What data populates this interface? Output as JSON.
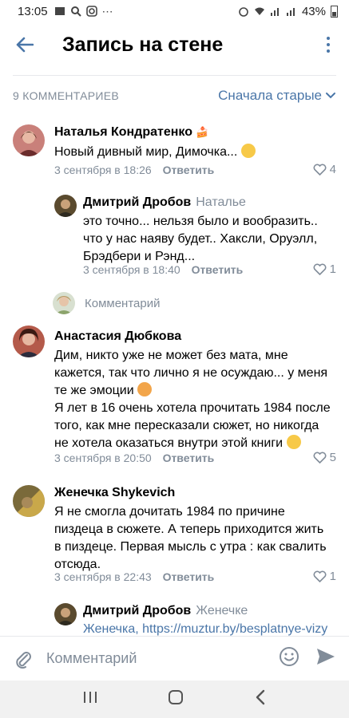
{
  "status": {
    "time": "13:05",
    "battery": "43%"
  },
  "header": {
    "title": "Запись на стене"
  },
  "comments_header": {
    "count": "9 КОММЕНТАРИЕВ",
    "sort": "Сначала старые"
  },
  "comments": [
    {
      "author": "Наталья Кондратенко",
      "text": "Новый дивный мир, Димочка...",
      "date": "3 сентября в 18:26",
      "reply_label": "Ответить",
      "likes": "4"
    },
    {
      "author": "Дмитрий Дробов",
      "to": "Наталье",
      "text": "это точно... нельзя было и вообразить.. что у нас наяву будет.. Хаксли, Оруэлл, Брэдбери и Рэнд...",
      "date": "3 сентября в 18:40",
      "reply_label": "Ответить",
      "likes": "1"
    },
    {
      "author": "Анастасия Дюбкова",
      "text1": "Дим, никто уже не может без мата, мне кажется, так что лично я не осуждаю... у меня те же эмоции",
      "text2": "Я лет в 16 очень хотела прочитать 1984 после того, как мне пересказали сюжет, но никогда не хотела оказаться внутри этой книги",
      "date": "3 сентября в 20:50",
      "reply_label": "Ответить",
      "likes": "5"
    },
    {
      "author": "Женечка Shykevich",
      "text": "Я не смогла дочитать 1984 по причине пиздеца в сюжете. А теперь приходится жить в пиздеце. Первая мысль с утра : как свалить отсюда.",
      "date": "3 сентября в 22:43",
      "reply_label": "Ответить",
      "likes": "1"
    },
    {
      "author": "Дмитрий Дробов",
      "to": "Женечке",
      "text_name": "Женечка",
      "text_link": "https://muztur.by/besplatnye-vizy"
    }
  ],
  "reply_input": {
    "label": "Комментарий"
  },
  "composer": {
    "placeholder": "Комментарий"
  },
  "colors": {
    "accent": "#4a76a8",
    "secondary": "#818c99"
  }
}
